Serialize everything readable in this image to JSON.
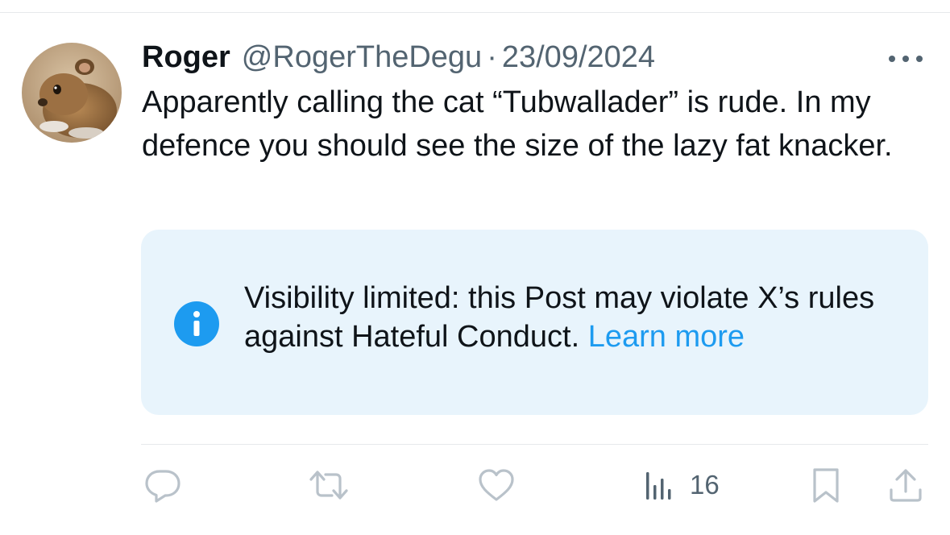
{
  "post": {
    "author": {
      "display_name": "Roger",
      "handle": "@RogerTheDegu",
      "avatar_icon": "degu-avatar"
    },
    "separator": "·",
    "date": "23/09/2024",
    "text": "Apparently calling the cat “Tubwallader” is rude. In my defence you should see the size of the lazy fat knacker.",
    "notice": {
      "icon": "info-icon",
      "message": "Visibility limited: this Post may violate X’s rules against Hateful Conduct.",
      "link": "Learn more"
    },
    "actions": {
      "reply_icon": "reply-icon",
      "repost_icon": "repost-icon",
      "like_icon": "heart-icon",
      "views_icon": "views-chart-icon",
      "views_count": "16",
      "bookmark_icon": "bookmark-icon",
      "share_icon": "share-icon"
    }
  },
  "colors": {
    "text_primary": "#0f1419",
    "text_secondary": "#536471",
    "link": "#1d9bf0",
    "notice_background": "#e8f4fc",
    "divider": "#e6e9eb",
    "action_icon": "#b9c2ca"
  }
}
